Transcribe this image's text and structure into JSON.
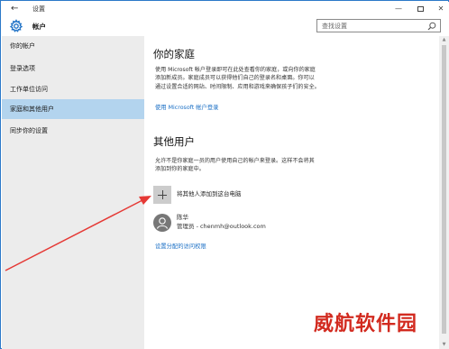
{
  "window": {
    "title": "设置",
    "back_icon": "back-arrow-icon",
    "minimize": "—",
    "close": "✕"
  },
  "header": {
    "icon": "gear-icon",
    "title": "帐户"
  },
  "search": {
    "placeholder": "查找设置",
    "icon": "search-icon"
  },
  "sidebar": {
    "items": [
      {
        "label": "你的帐户",
        "active": false
      },
      {
        "label": "登录选项",
        "active": false
      },
      {
        "label": "工作单位访问",
        "active": false
      },
      {
        "label": "家庭和其他用户",
        "active": true
      },
      {
        "label": "同步你的设置",
        "active": false
      }
    ]
  },
  "family": {
    "heading": "你的家庭",
    "description": [
      "使用 Microsoft 帐户登录即可在此处查看你的家庭，或向你的家庭",
      "添加新成员。家庭成员可以获得他们自己的登录名和桌面。你可以",
      "通过设置合适的网站、时间限制、应用和游戏来确保孩子们的安全。"
    ],
    "signin_link": "使用 Microsoft 帐户登录"
  },
  "other_users": {
    "heading": "其他用户",
    "description": [
      "允许不是你家庭一员的用户使用自己的帐户来登录。这样不会将其",
      "添加到你的家庭中。"
    ],
    "add_label": "将其他人添加到这台电脑",
    "add_icon": "plus-icon",
    "user": {
      "name": "陈华",
      "role": "管理员 - chenmh@outlook.com",
      "avatar_icon": "person-icon"
    },
    "access_link": "设置分配的访问权限"
  },
  "watermark": "威航软件园",
  "colors": {
    "accent": "#1a6fc5",
    "sidebar_bg": "#ececec",
    "sidebar_active": "#b3d4ee",
    "annotation_arrow": "#e53935",
    "watermark": "#d22a1f"
  }
}
